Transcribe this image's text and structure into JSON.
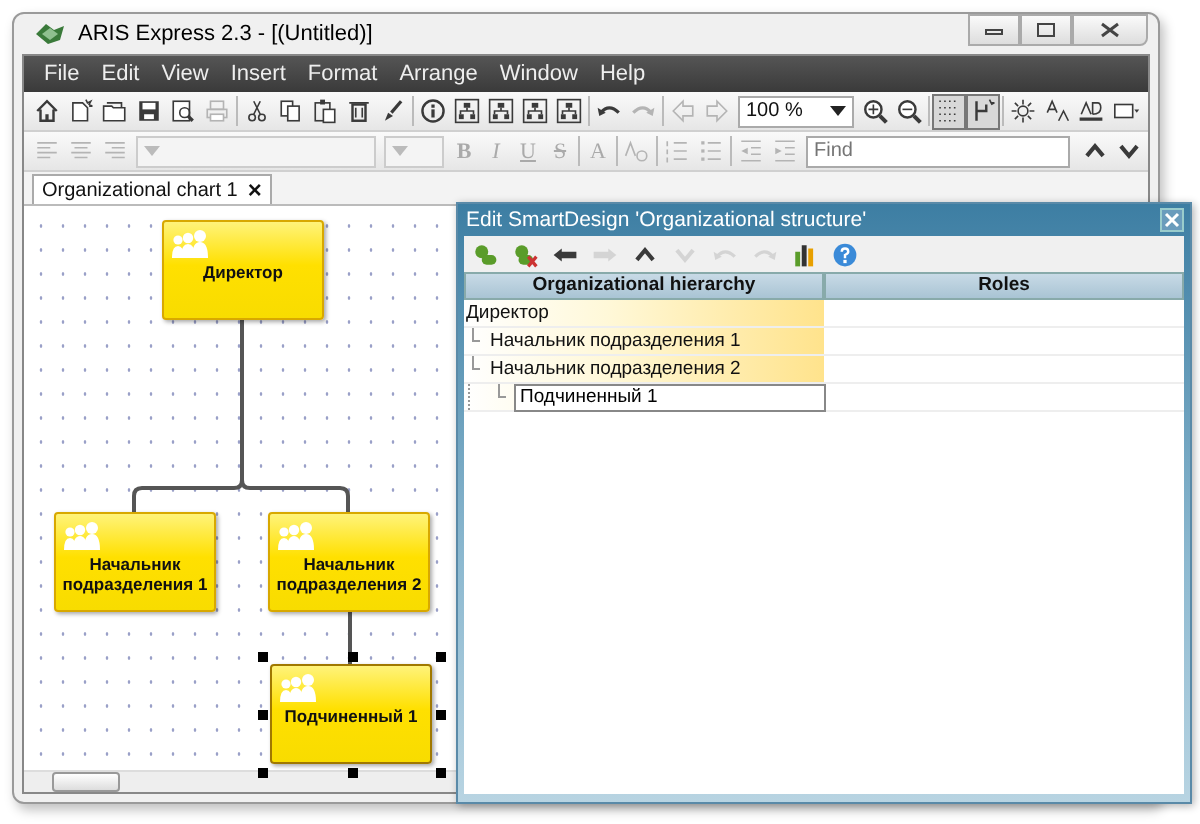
{
  "window": {
    "title": "ARIS Express 2.3 - [(Untitled)]"
  },
  "menu": [
    "File",
    "Edit",
    "View",
    "Insert",
    "Format",
    "Arrange",
    "Window",
    "Help"
  ],
  "toolbar": [
    {
      "kind": "home",
      "disabled": false,
      "pressed": false
    },
    {
      "kind": "new",
      "disabled": false,
      "pressed": false
    },
    {
      "kind": "open",
      "disabled": false,
      "pressed": false
    },
    {
      "kind": "save",
      "disabled": false,
      "pressed": false
    },
    {
      "kind": "preview",
      "disabled": false,
      "pressed": false
    },
    {
      "kind": "print",
      "disabled": true,
      "pressed": false
    },
    {
      "kind": "sep"
    },
    {
      "kind": "cut",
      "disabled": false,
      "pressed": false
    },
    {
      "kind": "copy",
      "disabled": false,
      "pressed": false
    },
    {
      "kind": "paste",
      "disabled": false,
      "pressed": false
    },
    {
      "kind": "delete",
      "disabled": false,
      "pressed": false
    },
    {
      "kind": "brush",
      "disabled": false,
      "pressed": false
    },
    {
      "kind": "sep"
    },
    {
      "kind": "info",
      "disabled": false,
      "pressed": false
    },
    {
      "kind": "layout",
      "disabled": false,
      "pressed": false
    },
    {
      "kind": "layout",
      "disabled": false,
      "pressed": false
    },
    {
      "kind": "layout",
      "disabled": false,
      "pressed": false
    },
    {
      "kind": "layout",
      "disabled": false,
      "pressed": false
    },
    {
      "kind": "sep"
    },
    {
      "kind": "undo",
      "disabled": false,
      "pressed": false
    },
    {
      "kind": "redo",
      "disabled": true,
      "pressed": false
    },
    {
      "kind": "sep"
    },
    {
      "kind": "back",
      "disabled": true,
      "pressed": false
    },
    {
      "kind": "forward",
      "disabled": true,
      "pressed": false
    },
    {
      "kind": "combo",
      "value": "100 %",
      "disabled": false
    },
    {
      "kind": "zoomin",
      "disabled": false,
      "pressed": false
    },
    {
      "kind": "zoomout",
      "disabled": false,
      "pressed": false
    },
    {
      "kind": "sep"
    },
    {
      "kind": "grid",
      "disabled": false,
      "pressed": true
    },
    {
      "kind": "connector",
      "disabled": false,
      "pressed": true
    },
    {
      "kind": "sep"
    },
    {
      "kind": "sun",
      "disabled": false,
      "pressed": false
    },
    {
      "kind": "textstyle",
      "disabled": false,
      "pressed": false
    },
    {
      "kind": "textline",
      "disabled": false,
      "pressed": false
    },
    {
      "kind": "shape",
      "disabled": false,
      "pressed": false
    }
  ],
  "format_bar": [
    {
      "kind": "alignleft",
      "disabled": true
    },
    {
      "kind": "aligncenter",
      "disabled": true
    },
    {
      "kind": "alignright",
      "disabled": true
    },
    {
      "kind": "fontcombo",
      "disabled": true
    },
    {
      "kind": "sizecombo",
      "disabled": true
    },
    {
      "kind": "bold",
      "label": "B",
      "disabled": true
    },
    {
      "kind": "italic",
      "label": "I",
      "disabled": true
    },
    {
      "kind": "underline",
      "label": "U",
      "disabled": true
    },
    {
      "kind": "strike",
      "label": "S",
      "disabled": true
    },
    {
      "kind": "sep"
    },
    {
      "kind": "fontcolor",
      "label": "A",
      "disabled": true
    },
    {
      "kind": "sep"
    },
    {
      "kind": "format",
      "disabled": true
    },
    {
      "kind": "sep"
    },
    {
      "kind": "numbers",
      "disabled": true
    },
    {
      "kind": "bullets",
      "disabled": true
    },
    {
      "kind": "sep"
    },
    {
      "kind": "outdent",
      "disabled": true
    },
    {
      "kind": "indent",
      "disabled": true
    },
    {
      "kind": "find",
      "placeholder": "Find"
    },
    {
      "kind": "up",
      "disabled": false
    },
    {
      "kind": "down",
      "disabled": false
    }
  ],
  "tabs": [
    {
      "label": "Organizational chart 1",
      "close": "×",
      "selected": true
    }
  ],
  "diagram": {
    "nodes": [
      {
        "label": "Директор",
        "selected": false
      },
      {
        "label": "Начальник подразделения 1",
        "selected": false
      },
      {
        "label": "Начальник подразделения 2",
        "selected": false
      },
      {
        "label": "Подчиненный 1",
        "selected": true
      }
    ]
  },
  "dialog": {
    "title": "Edit SmartDesign 'Organizational structure'",
    "toolbar": [
      {
        "kind": "add",
        "disabled": false
      },
      {
        "kind": "remove",
        "disabled": false
      },
      {
        "kind": "left",
        "disabled": false
      },
      {
        "kind": "right",
        "disabled": true
      },
      {
        "kind": "up",
        "disabled": false
      },
      {
        "kind": "down",
        "disabled": true
      },
      {
        "kind": "undo",
        "disabled": true
      },
      {
        "kind": "redo",
        "disabled": true
      },
      {
        "kind": "chart",
        "disabled": false
      },
      {
        "kind": "help",
        "disabled": false
      }
    ],
    "columns": [
      "Organizational hierarchy",
      "Roles"
    ],
    "tree": [
      {
        "label": "Директор",
        "editing": false,
        "children": [
          {
            "label": "Начальник подразделения 1",
            "editing": false
          },
          {
            "label": "Начальник подразделения 2",
            "editing": false,
            "children": [
              {
                "label": "Подчиненный 1",
                "editing": true
              }
            ]
          }
        ]
      }
    ]
  }
}
